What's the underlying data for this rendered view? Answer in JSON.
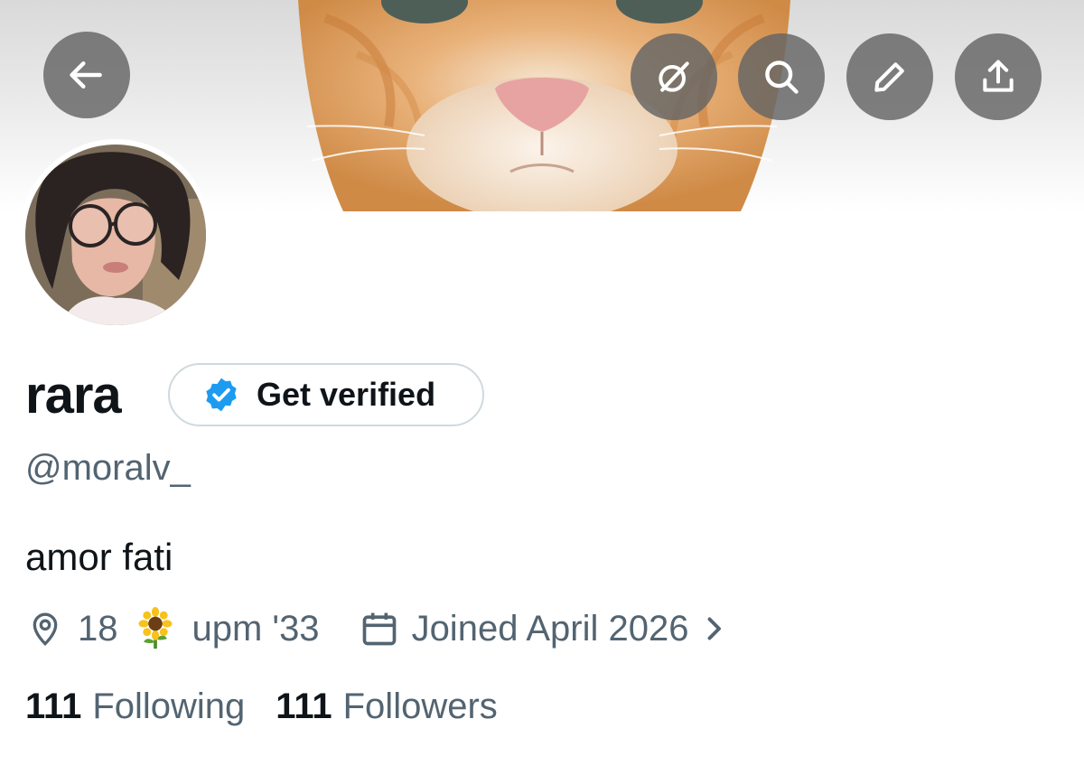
{
  "profile": {
    "display_name": "rara",
    "handle": "@moralv_",
    "bio": "amor fati",
    "verify_button_label": "Get verified"
  },
  "meta": {
    "location": "18",
    "location_suffix": "upm '33",
    "location_emoji": "sunflower",
    "joined": "Joined April 2026"
  },
  "stats": {
    "following_count": "111",
    "following_label": "Following",
    "followers_count": "111",
    "followers_label": "Followers"
  },
  "icons": {
    "back": "arrow-left-icon",
    "grok": "grok-icon",
    "search": "search-icon",
    "edit": "pencil-icon",
    "share": "share-icon",
    "verified": "verified-badge-icon",
    "location": "location-pin-icon",
    "calendar": "calendar-icon",
    "chevron": "chevron-right-icon"
  },
  "colors": {
    "accent_blue": "#1d9bf0",
    "text_primary": "#0f1419",
    "text_secondary": "#536471",
    "button_overlay": "#646464"
  }
}
